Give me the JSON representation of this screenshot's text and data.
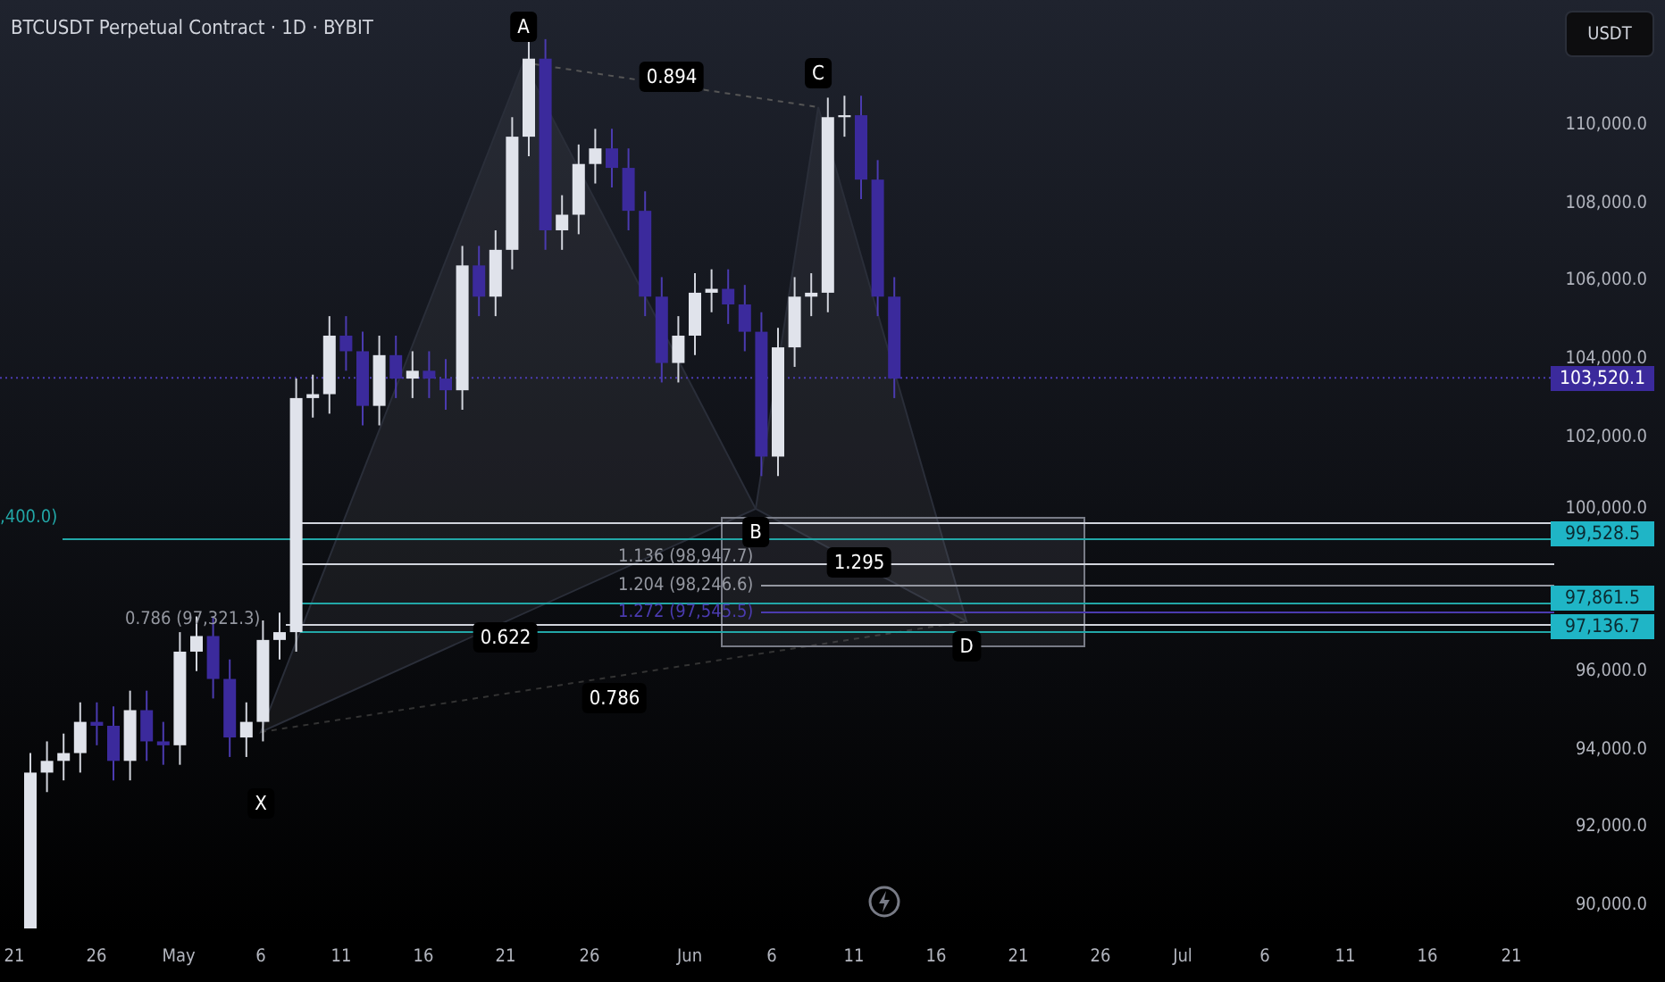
{
  "title": "BTCUSDT Perpetual Contract · 1D · BYBIT",
  "currency": "USDT",
  "price_ticks": [
    "110,000.0",
    "108,000.0",
    "106,000.0",
    "104,000.0",
    "102,000.0",
    "100,000.0",
    "96,000.0",
    "94,000.0",
    "92,000.0",
    "90,000.0"
  ],
  "current_price": "103,520.1",
  "level_badges": [
    "99,528.5",
    "97,861.5",
    "97,136.7"
  ],
  "date_ticks": [
    "21",
    "26",
    "May",
    "6",
    "11",
    "16",
    "21",
    "26",
    "Jun",
    "6",
    "11",
    "16",
    "21",
    "26",
    "Jul",
    "6",
    "11",
    "16",
    "21"
  ],
  "pattern_points": [
    "X",
    "A",
    "B",
    "C",
    "D"
  ],
  "ratios": [
    "0.894",
    "0.622",
    "1.295",
    "0.786"
  ],
  "fib_labels": [
    {
      "label": ",400.0)",
      "color": "#22a7a7"
    },
    {
      "label": "0.786 (97,321.3)",
      "color": "#9598a1"
    },
    {
      "label": "1.136 (98,947.7)",
      "color": "#9598a1"
    },
    {
      "label": "1.204 (98,246.6)",
      "color": "#9598a1"
    },
    {
      "label": "1.272 (97,545.5)",
      "color": "#4b3bb0"
    }
  ]
}
